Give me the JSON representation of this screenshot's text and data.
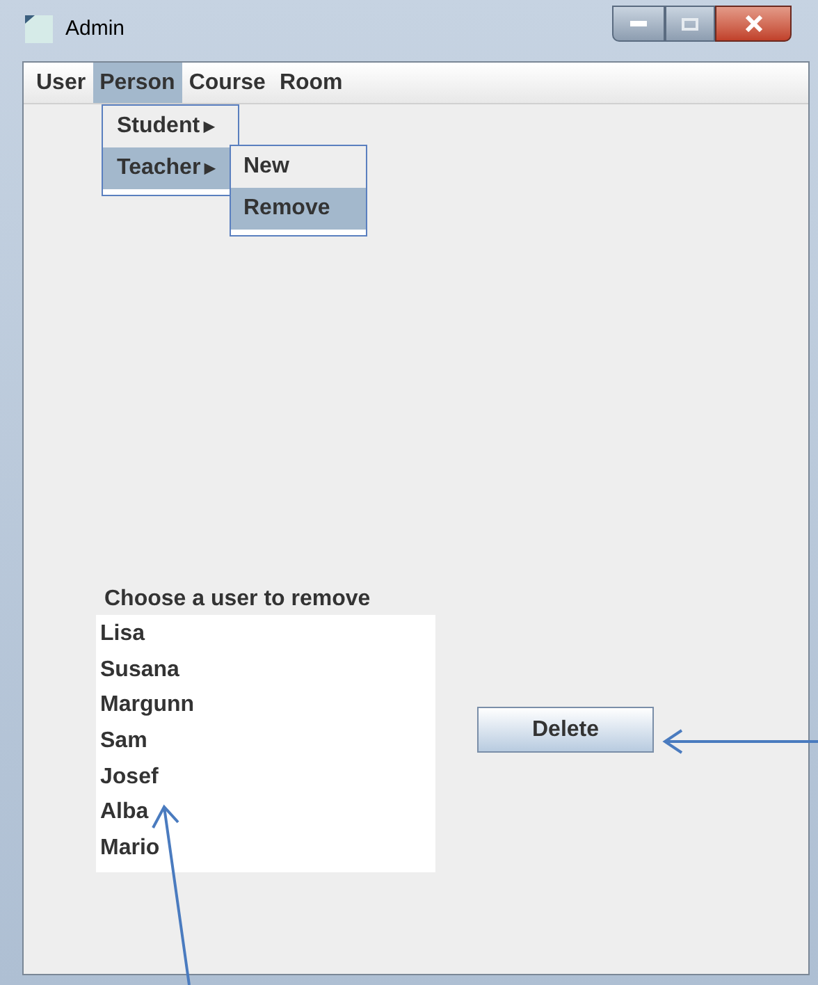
{
  "window": {
    "title": "Admin"
  },
  "menu_bar": [
    {
      "label": "User",
      "selected": false
    },
    {
      "label": "Person",
      "selected": true
    },
    {
      "label": "Course",
      "selected": false
    },
    {
      "label": "Room",
      "selected": false
    }
  ],
  "menu": [
    {
      "label": "Student",
      "arrow": "▶",
      "selected": false
    },
    {
      "label": "Teacher",
      "arrow": "▶",
      "selected": true
    }
  ],
  "submenu": [
    {
      "label": "New",
      "selected": false
    },
    {
      "label": "Remove",
      "selected": true
    }
  ],
  "prompt": "Choose a user to remove",
  "users": [
    "Lisa",
    "Susana",
    "Margunn",
    "Sam",
    "Josef",
    "Alba",
    "Mario"
  ],
  "button": "Delete"
}
